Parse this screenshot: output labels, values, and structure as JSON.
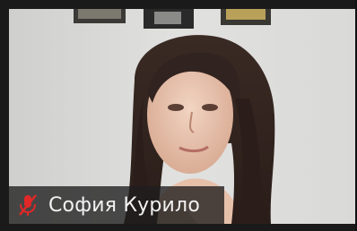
{
  "participant": {
    "name": "София Курило",
    "mic_icon": "mic-muted-icon",
    "mic_color": "#e02828"
  }
}
